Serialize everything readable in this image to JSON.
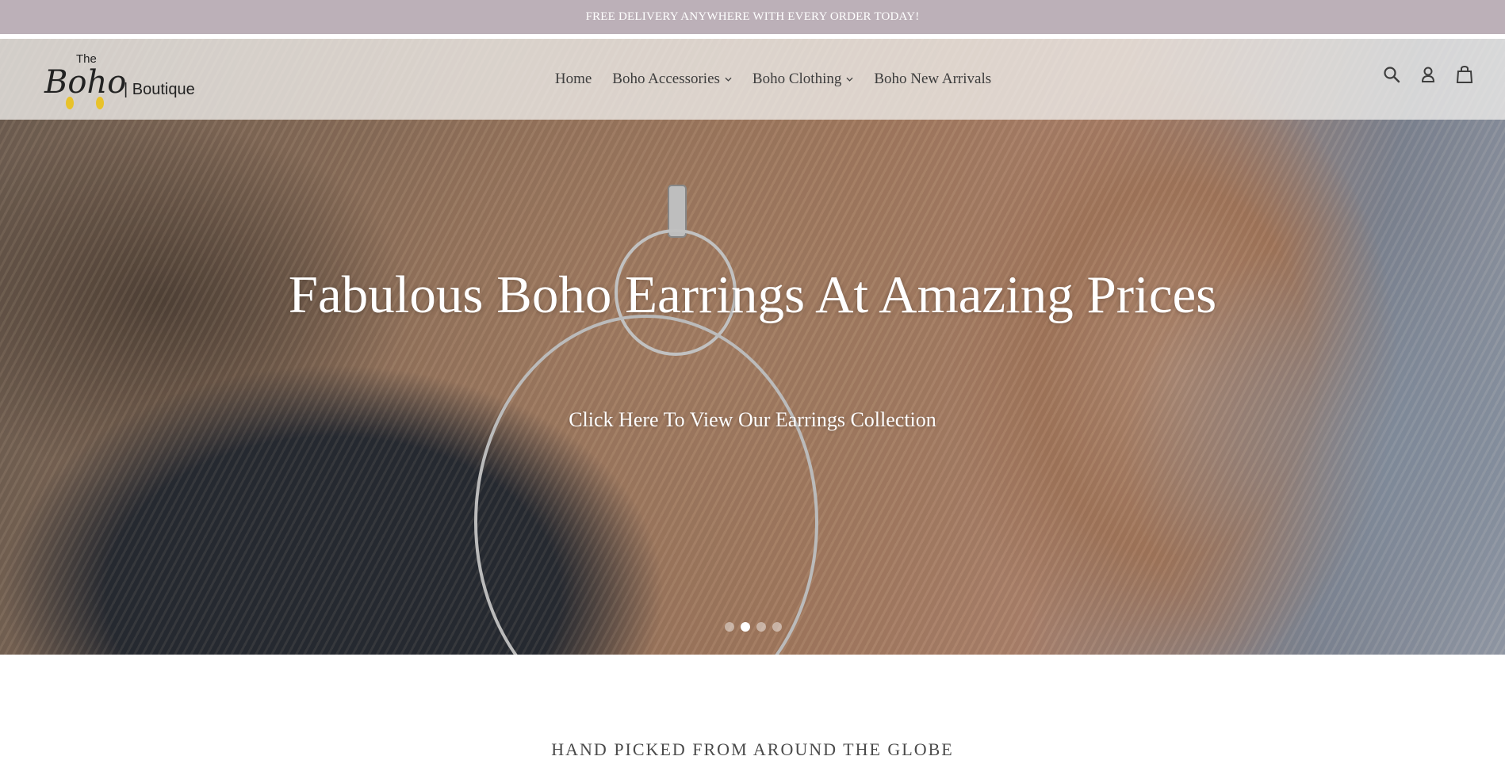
{
  "announcement": {
    "text": "FREE DELIVERY ANYWHERE WITH EVERY ORDER TODAY!"
  },
  "logo": {
    "line1": "The",
    "line2": "Boho",
    "line3": "| Boutique"
  },
  "nav": [
    {
      "label": "Home",
      "has_dropdown": false
    },
    {
      "label": "Boho Accessories",
      "has_dropdown": true
    },
    {
      "label": "Boho Clothing",
      "has_dropdown": true
    },
    {
      "label": "Boho New Arrivals",
      "has_dropdown": false
    }
  ],
  "header_icons": [
    "search-icon",
    "account-icon",
    "cart-icon"
  ],
  "hero": {
    "headline": "Fabulous Boho Earrings At Amazing Prices",
    "cta": "Click Here To View Our Earrings Collection",
    "slides": 4,
    "active_slide": 2
  },
  "section": {
    "tagline": "HAND PICKED FROM AROUND THE GLOBE"
  },
  "colors": {
    "announcement_bg": "#bcb0b8",
    "text_dark": "#3d3d3d",
    "white": "#ffffff",
    "logo_accent": "#e8c22a"
  }
}
